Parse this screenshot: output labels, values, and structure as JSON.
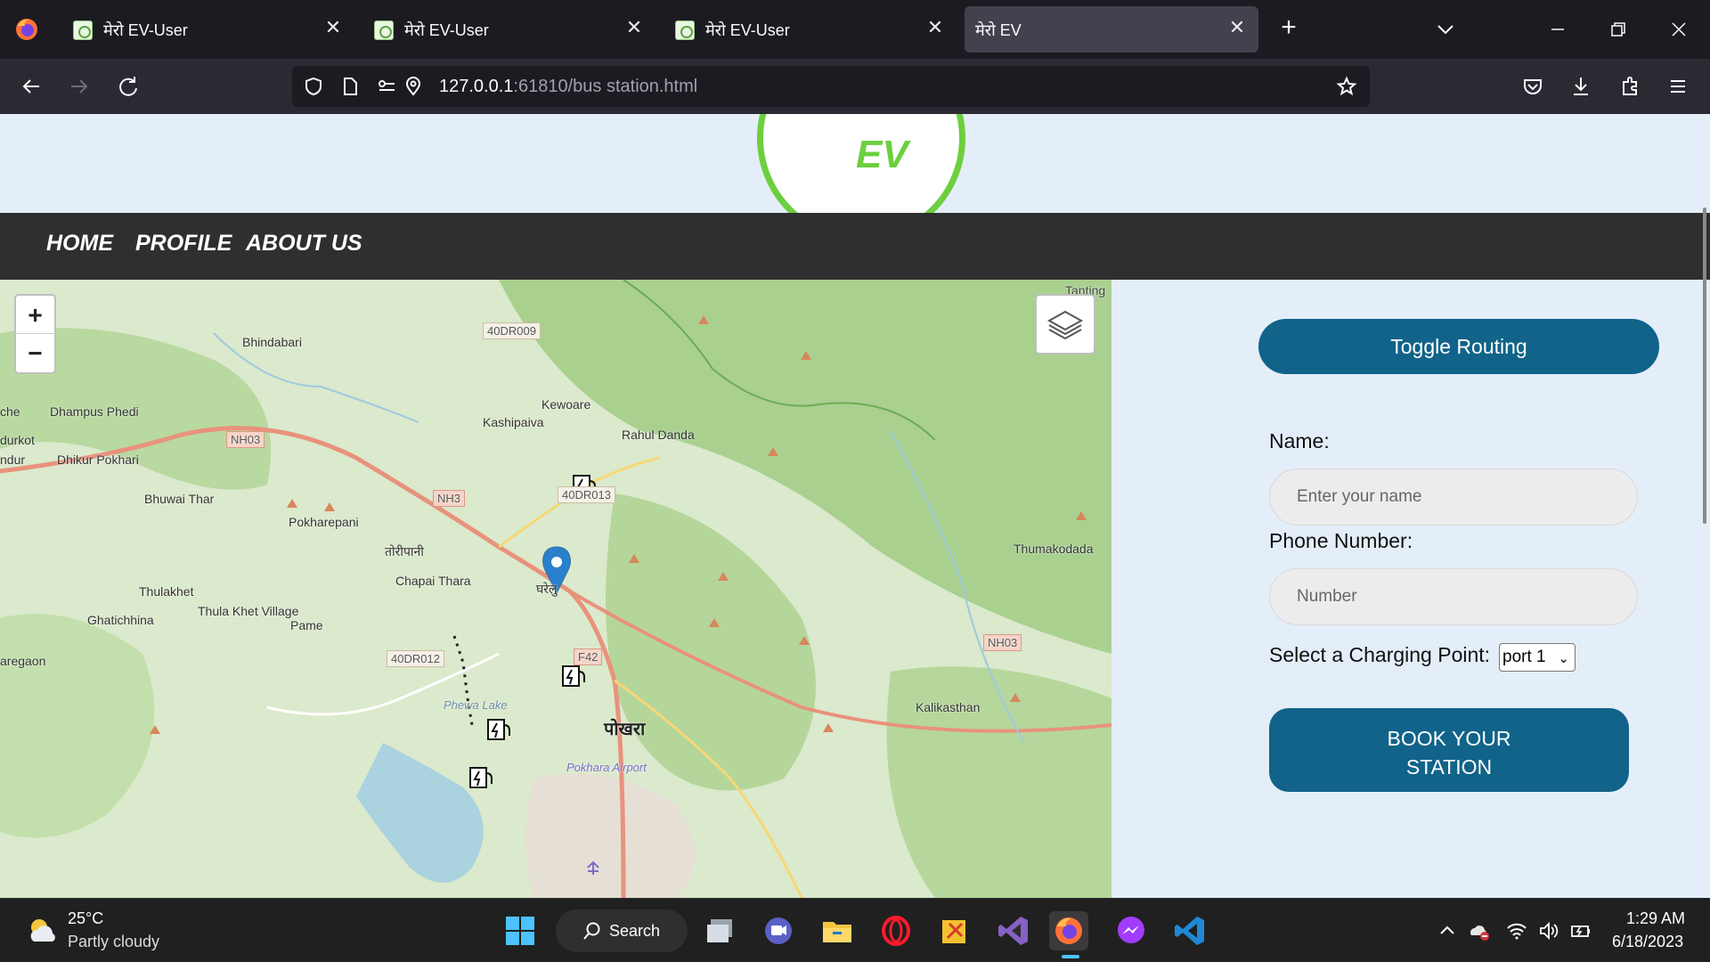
{
  "browser": {
    "tabs": [
      {
        "title": "मेरो EV-User",
        "active": false
      },
      {
        "title": "मेरो EV-User",
        "active": false
      },
      {
        "title": "मेरो EV-User",
        "active": false
      },
      {
        "title": "मेरो EV",
        "active": true
      }
    ],
    "url_host": "127.0.0.1",
    "url_rest": ":61810/bus station.html",
    "new_tab_icon": "plus-icon"
  },
  "page": {
    "logo_text": "EV",
    "nav": [
      {
        "label": "HOME"
      },
      {
        "label": "PROFILE"
      },
      {
        "label": "ABOUT US"
      }
    ],
    "map": {
      "zoom_in": "+",
      "zoom_out": "−",
      "places": [
        "Tanting",
        "40DR009",
        "Bhindabari",
        "Kewoare",
        "Kashipaiva",
        "Rahul Danda",
        "Dhampus Phedi",
        "NH03",
        "Dhikur Pokhari",
        "NH3",
        "Bhuwai Thar",
        "Pokharepani",
        "40DR013",
        "तोरीपानी",
        "Chapai Thara",
        "Thulakhet",
        "Thula Khet Village",
        "Ghatichhina",
        "Pame",
        "घरेलु",
        "40DR012",
        "F42",
        "Phewa Lake",
        "पोखरा",
        "Pokhara Airport",
        "Thumakodada",
        "NH03",
        "Kalikasthan",
        "aregaon",
        "durkot",
        "ndur",
        "che"
      ]
    },
    "panel": {
      "toggle_label": "Toggle Routing",
      "name_label": "Name:",
      "name_placeholder": "Enter your name",
      "phone_label": "Phone Number:",
      "phone_placeholder": "Number",
      "charging_label": "Select a Charging Point:",
      "charging_value": "port 1",
      "book_line1": "BOOK YOUR",
      "book_line2": "STATION"
    }
  },
  "taskbar": {
    "temp": "25°C",
    "weather": "Partly cloudy",
    "search_label": "Search",
    "time": "1:29 AM",
    "date": "6/18/2023"
  }
}
